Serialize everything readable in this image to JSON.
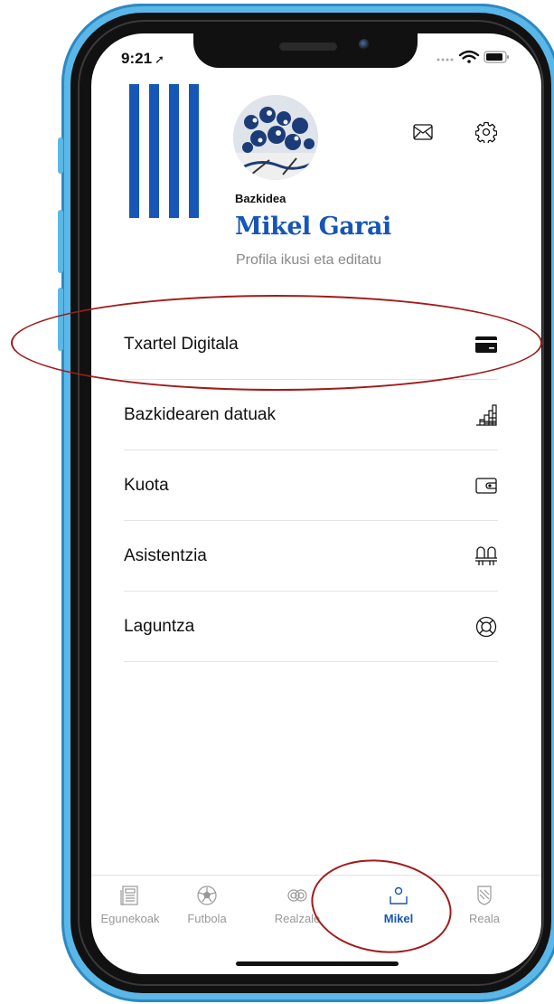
{
  "status_bar": {
    "time": "9:21"
  },
  "profile": {
    "member_label": "Bazkidea",
    "name": "Mikel Garai",
    "link": "Profila ikusi eta editatu"
  },
  "header_icons": {
    "mail": "mail-icon",
    "settings": "gear-icon"
  },
  "menu": {
    "items": [
      {
        "label": "Txartel Digitala",
        "icon": "card-icon"
      },
      {
        "label": "Bazkidearen datuak",
        "icon": "stadium-stairs-icon"
      },
      {
        "label": "Kuota",
        "icon": "wallet-icon"
      },
      {
        "label": "Asistentzia",
        "icon": "seats-icon"
      },
      {
        "label": "Laguntza",
        "icon": "lifebuoy-icon"
      }
    ]
  },
  "tabbar": {
    "tabs": [
      {
        "label": "Egunekoak",
        "icon": "newspaper-icon",
        "active": false
      },
      {
        "label": "Futbola",
        "icon": "football-icon",
        "active": false
      },
      {
        "label": "Realzale",
        "icon": "rings-icon",
        "active": false
      },
      {
        "label": "Mikel",
        "icon": "user-icon",
        "active": true
      },
      {
        "label": "Reala",
        "icon": "crest-icon",
        "active": false
      }
    ]
  },
  "colors": {
    "brand": "#1556b7",
    "annotation": "#a11b1b",
    "frame": "#5ab8e8"
  }
}
